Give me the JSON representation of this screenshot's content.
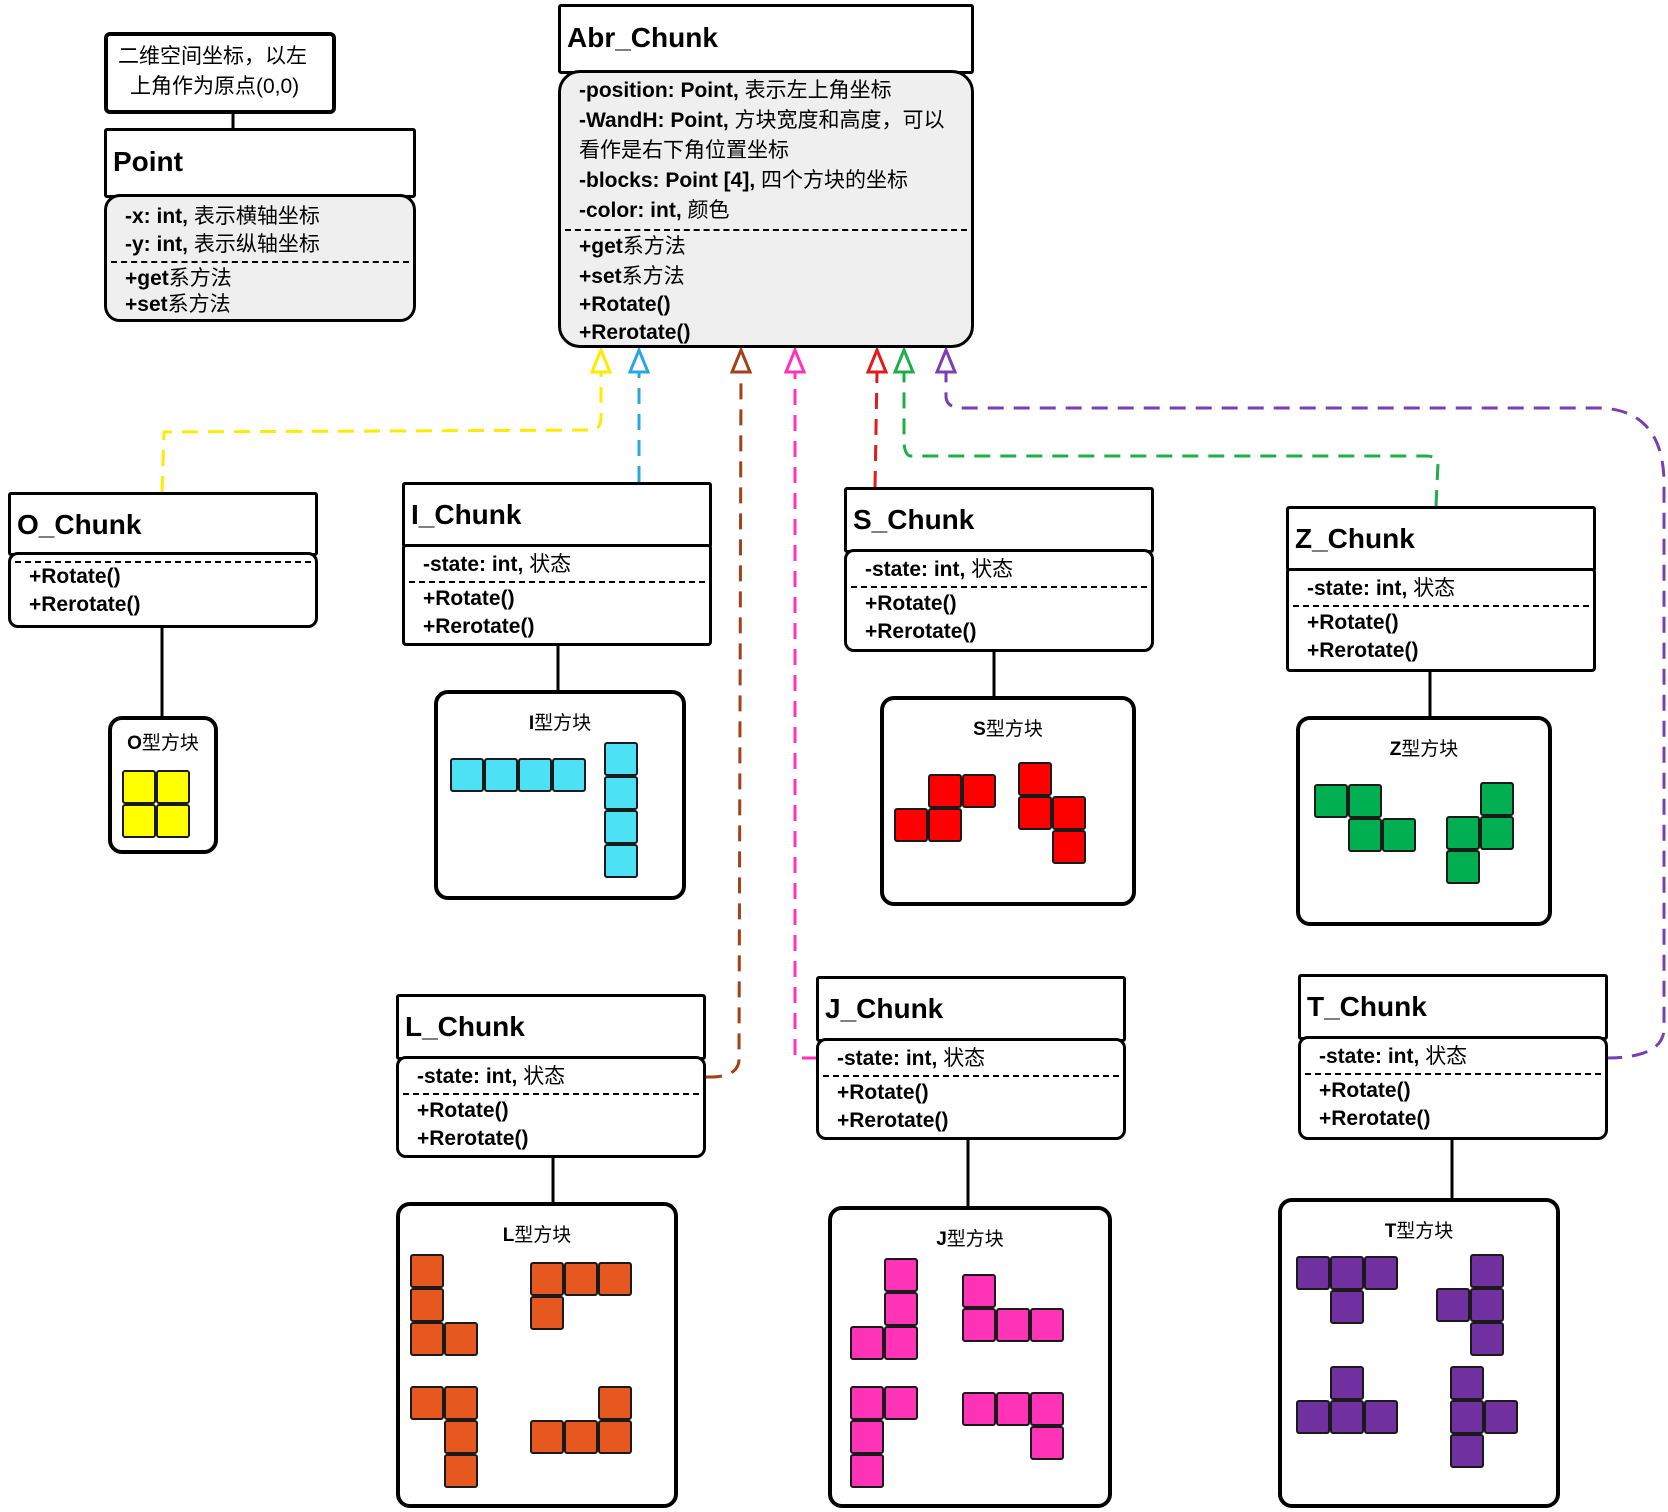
{
  "note": {
    "line1": "二维空间坐标，以左",
    "line2": "上角作为原点(0,0)"
  },
  "point_class": {
    "name": "Point",
    "attributes": [
      {
        "sig": "-x: int,",
        "desc": "表示横轴坐标"
      },
      {
        "sig": "-y: int,",
        "desc": "表示纵轴坐标"
      }
    ],
    "methods": [
      {
        "sig": "+get",
        "desc": "系方法"
      },
      {
        "sig": "+set",
        "desc": "系方法"
      }
    ]
  },
  "abr_class": {
    "name": "Abr_Chunk",
    "attributes": [
      {
        "sig": "-position: Point,",
        "desc": "表示左上角坐标"
      },
      {
        "sig": "-WandH: Point,",
        "desc": "方块宽度和高度，可以"
      },
      {
        "sig": "",
        "desc": "看作是右下角位置坐标"
      },
      {
        "sig": "-blocks: Point [4],",
        "desc": "四个方块的坐标"
      },
      {
        "sig": "-color: int,",
        "desc": "颜色"
      }
    ],
    "methods": [
      {
        "sig": "+get",
        "desc": "系方法"
      },
      {
        "sig": "+set",
        "desc": "系方法"
      },
      {
        "sig": "+Rotate()",
        "desc": ""
      },
      {
        "sig": "+Rerotate()",
        "desc": ""
      }
    ]
  },
  "state_attr": {
    "sig": "-state: int,",
    "desc": "状态"
  },
  "methods_common": {
    "rotate": "+Rotate()",
    "rerotate": "+Rerotate()"
  },
  "chunks": [
    {
      "id": "O",
      "name": "O_Chunk",
      "shape_label": "O",
      "shape_suffix": "型方块",
      "color": "#ffff00",
      "line": "#ffea00"
    },
    {
      "id": "I",
      "name": "I_Chunk",
      "shape_label": "I",
      "shape_suffix": "型方块",
      "color": "#4de1f5",
      "line": "#29a8e0"
    },
    {
      "id": "S",
      "name": "S_Chunk",
      "shape_label": "S",
      "shape_suffix": "型方块",
      "color": "#ff0000",
      "line": "#e21a1a"
    },
    {
      "id": "Z",
      "name": "Z_Chunk",
      "shape_label": "Z",
      "shape_suffix": "型方块",
      "color": "#00b050",
      "line": "#1fae4b"
    },
    {
      "id": "L",
      "name": "L_Chunk",
      "shape_label": "L",
      "shape_suffix": "型方块",
      "color": "#e6581f",
      "line": "#a0421a"
    },
    {
      "id": "J",
      "name": "J_Chunk",
      "shape_label": "J",
      "shape_suffix": "型方块",
      "color": "#ff33b8",
      "line": "#ff33b8"
    },
    {
      "id": "T",
      "name": "T_Chunk",
      "shape_label": "T",
      "shape_suffix": "型方块",
      "color": "#7030a0",
      "line": "#7a3fb0"
    }
  ]
}
